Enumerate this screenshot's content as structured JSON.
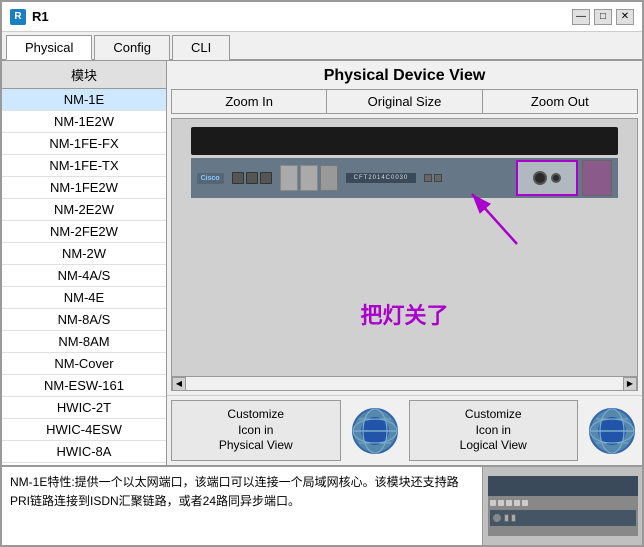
{
  "window": {
    "title": "R1",
    "icon": "R"
  },
  "titlebar": {
    "minimize": "—",
    "maximize": "□",
    "close": "✕"
  },
  "tabs": [
    {
      "label": "Physical",
      "active": true
    },
    {
      "label": "Config",
      "active": false
    },
    {
      "label": "CLI",
      "active": false
    }
  ],
  "sidebar": {
    "header": "模块",
    "items": [
      {
        "label": "NM-1E"
      },
      {
        "label": "NM-1E2W"
      },
      {
        "label": "NM-1FE-FX"
      },
      {
        "label": "NM-1FE-TX"
      },
      {
        "label": "NM-1FE2W"
      },
      {
        "label": "NM-2E2W"
      },
      {
        "label": "NM-2FE2W"
      },
      {
        "label": "NM-2W"
      },
      {
        "label": "NM-4A/S"
      },
      {
        "label": "NM-4E"
      },
      {
        "label": "NM-8A/S"
      },
      {
        "label": "NM-8AM"
      },
      {
        "label": "NM-Cover"
      },
      {
        "label": "NM-ESW-161"
      },
      {
        "label": "HWIC-2T"
      },
      {
        "label": "HWIC-4ESW"
      },
      {
        "label": "HWIC-8A"
      }
    ]
  },
  "main": {
    "title": "Physical Device View",
    "zoom_in": "Zoom In",
    "original_size": "Original Size",
    "zoom_out": "Zoom Out"
  },
  "annotation": {
    "text": "把灯关了"
  },
  "bottom_buttons": {
    "customize_physical": "Customize\nIcon in\nPhysical View",
    "customize_logical": "Customize\nIcon in\nLogical View"
  },
  "info": {
    "text": "NM-1E特性:提供一个以太网端口，该端口可以连接一个局域网核心。该模块还支持路PRI链路连接到ISDN汇聚链路，或者24路同异步端口。"
  }
}
